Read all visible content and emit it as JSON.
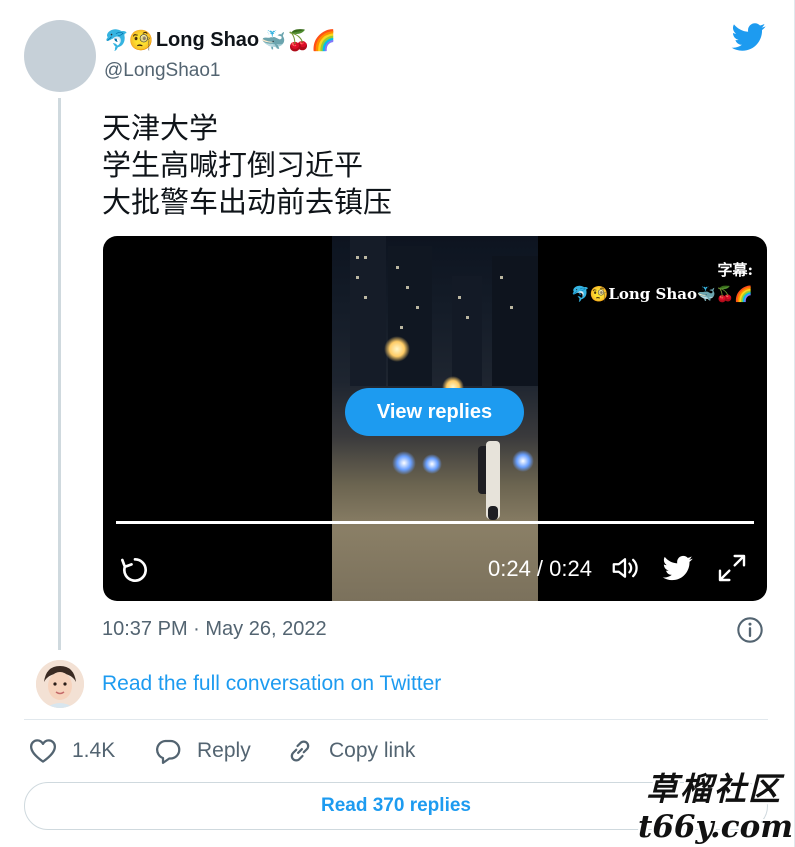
{
  "user": {
    "display_name_prefix_emoji": "🐬🧐",
    "display_name": "Long Shao",
    "display_name_suffix_emoji": "🐳🍒🌈",
    "handle": "@LongShao1"
  },
  "tweet": {
    "lines": [
      "天津大学",
      "学生高喊打倒习近平",
      "大批警车出动前去镇压"
    ],
    "timestamp": "10:37 PM · May 26, 2022"
  },
  "video": {
    "watermark_line1": "字幕:",
    "watermark_line2": "🐬🧐Long Shao🐳🍒🌈",
    "view_replies_label": "View replies",
    "time_display": "0:24 / 0:24",
    "progress_fraction": 1.0
  },
  "conversation": {
    "read_full_label": "Read the full conversation on Twitter"
  },
  "actions": {
    "like_count": "1.4K",
    "reply_label": "Reply",
    "copy_link_label": "Copy link"
  },
  "footer": {
    "read_replies_label": "Read 370 replies"
  },
  "site_watermark": {
    "line1": "草榴社区",
    "line2": "t66y.com"
  },
  "icons": {
    "top_right": "twitter-bird-icon",
    "replay": "replay-icon",
    "volume": "volume-icon",
    "video_bird": "twitter-bird-icon",
    "fullscreen": "fullscreen-icon",
    "info": "info-icon",
    "like": "heart-icon",
    "reply": "reply-icon",
    "copy": "link-icon"
  },
  "colors": {
    "accent": "#1d9bf0",
    "text": "#0f1419",
    "secondary": "#536471"
  }
}
